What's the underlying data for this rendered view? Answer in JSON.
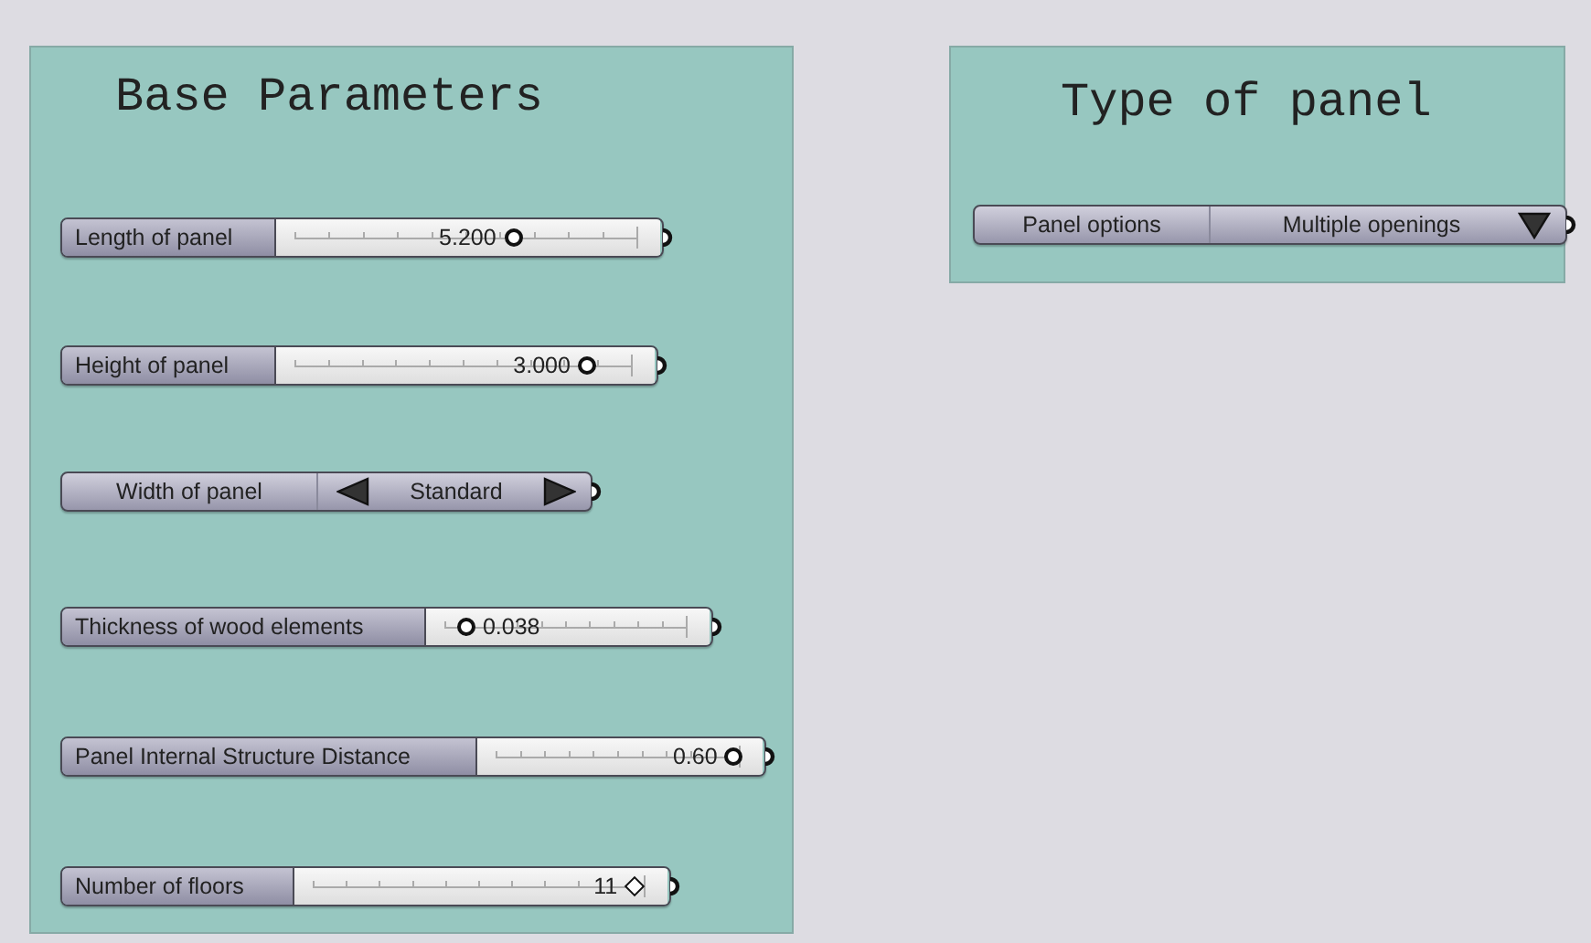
{
  "groups": [
    {
      "title": "Base Parameters",
      "components": [
        {
          "kind": "slider",
          "label": "Length of panel",
          "value": "5.200",
          "level": 0.64,
          "integer": false
        },
        {
          "kind": "slider",
          "label": "Height of panel",
          "value": "3.000",
          "level": 0.87,
          "integer": false
        },
        {
          "kind": "value-list",
          "label": "Width of panel",
          "value": "Standard"
        },
        {
          "kind": "slider",
          "label": "Thickness of wood elements",
          "value": "0.038",
          "level": 0.09,
          "integer": false
        },
        {
          "kind": "slider",
          "label": "Panel Internal Structure Distance",
          "value": "0.60",
          "level": 0.98,
          "integer": false
        },
        {
          "kind": "slider",
          "label": "Number of floors",
          "value": "11",
          "level": 0.97,
          "integer": true
        }
      ]
    },
    {
      "title": "Type of panel",
      "components": [
        {
          "kind": "dropdown",
          "label": "Panel options",
          "value": "Multiple openings"
        }
      ]
    }
  ]
}
